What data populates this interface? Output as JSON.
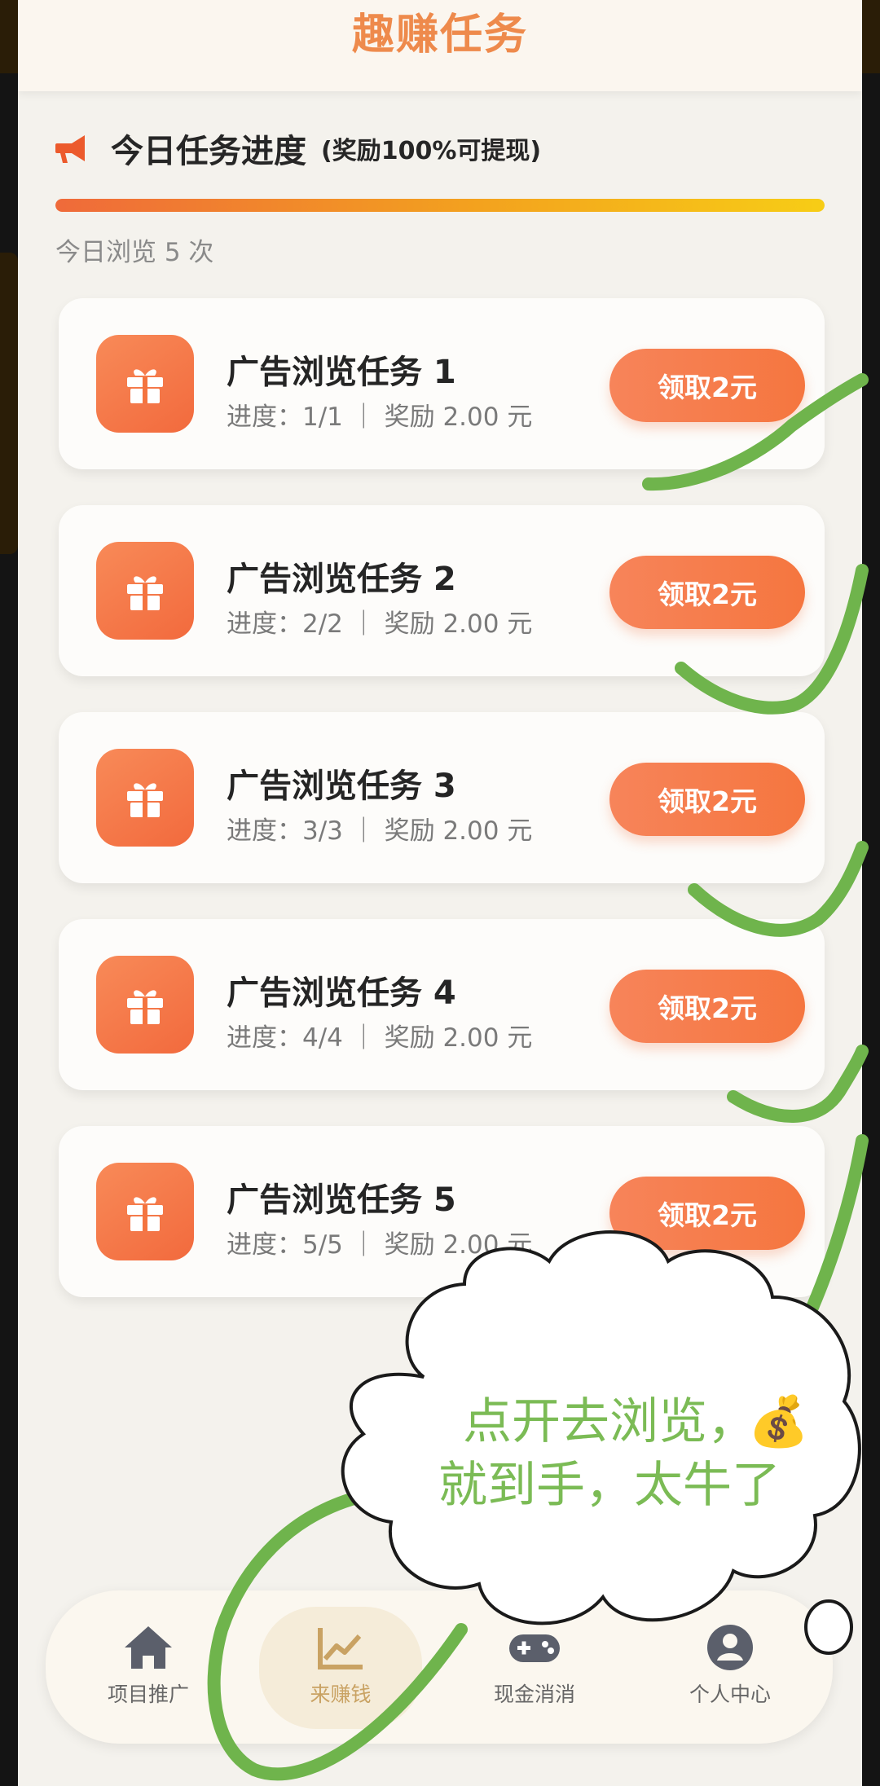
{
  "header": {
    "title": "趣赚任务"
  },
  "progress": {
    "title": "今日任务进度",
    "note": "(奖励100%可提现)",
    "fraction": 1.0,
    "views_text": "今日浏览 5 次"
  },
  "tasks": [
    {
      "name": "广告浏览任务 1",
      "meta": "进度：1/1 ｜ 奖励 2.00 元",
      "button": "领取2元"
    },
    {
      "name": "广告浏览任务 2",
      "meta": "进度：2/2 ｜ 奖励 2.00 元",
      "button": "领取2元"
    },
    {
      "name": "广告浏览任务 3",
      "meta": "进度：3/3 ｜ 奖励 2.00 元",
      "button": "领取2元"
    },
    {
      "name": "广告浏览任务 4",
      "meta": "进度：4/4 ｜ 奖励 2.00 元",
      "button": "领取2元"
    },
    {
      "name": "广告浏览任务 5",
      "meta": "进度：5/5 ｜ 奖励 2.00 元",
      "button": "领取2元"
    }
  ],
  "nav": [
    {
      "label": "项目推广",
      "icon": "home-icon"
    },
    {
      "label": "来赚钱",
      "icon": "chart-icon",
      "active": true
    },
    {
      "label": "现金消消",
      "icon": "gamepad-icon"
    },
    {
      "label": "个人中心",
      "icon": "user-icon"
    }
  ],
  "annotation": {
    "line1": "点开去浏览，",
    "line2": "就到手，太牛了",
    "emoji": "💰"
  },
  "colors": {
    "accent": "#f5763f",
    "title": "#ee8a4c",
    "checkmark": "#7bbb55"
  }
}
